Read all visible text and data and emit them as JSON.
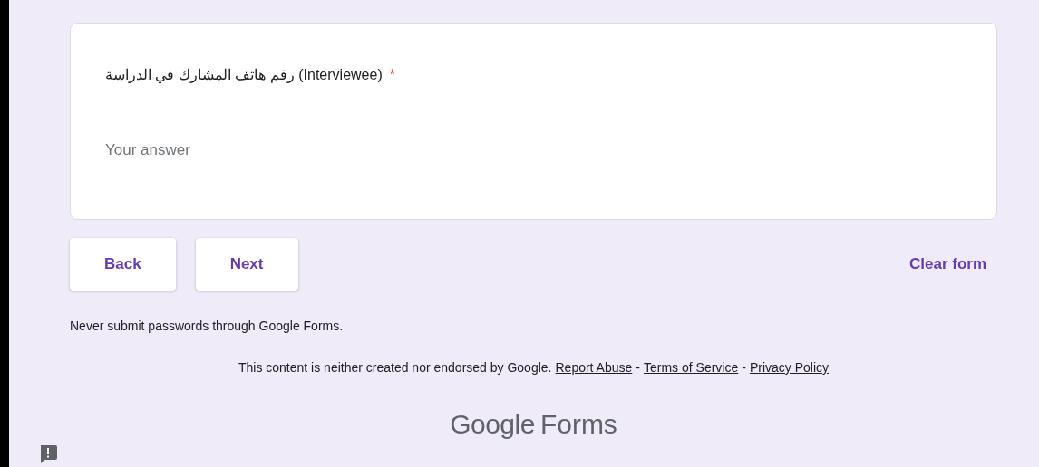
{
  "question": {
    "title": "رقم هاتف المشارك في الدراسة (Interviewee)",
    "required": true,
    "marker": "*",
    "placeholder": "Your answer"
  },
  "buttons": [
    {
      "label": "Back"
    },
    {
      "label": "Next"
    }
  ],
  "clear_form": "Clear form",
  "warning": "Never submit passwords through Google Forms.",
  "disclaimer": {
    "text": "This content is neither created nor endorsed by Google.",
    "links": [
      "Report Abuse",
      "Terms of Service",
      "Privacy Policy"
    ],
    "separator": "-"
  },
  "logo": {
    "brand": "Google",
    "product": "Forms"
  }
}
